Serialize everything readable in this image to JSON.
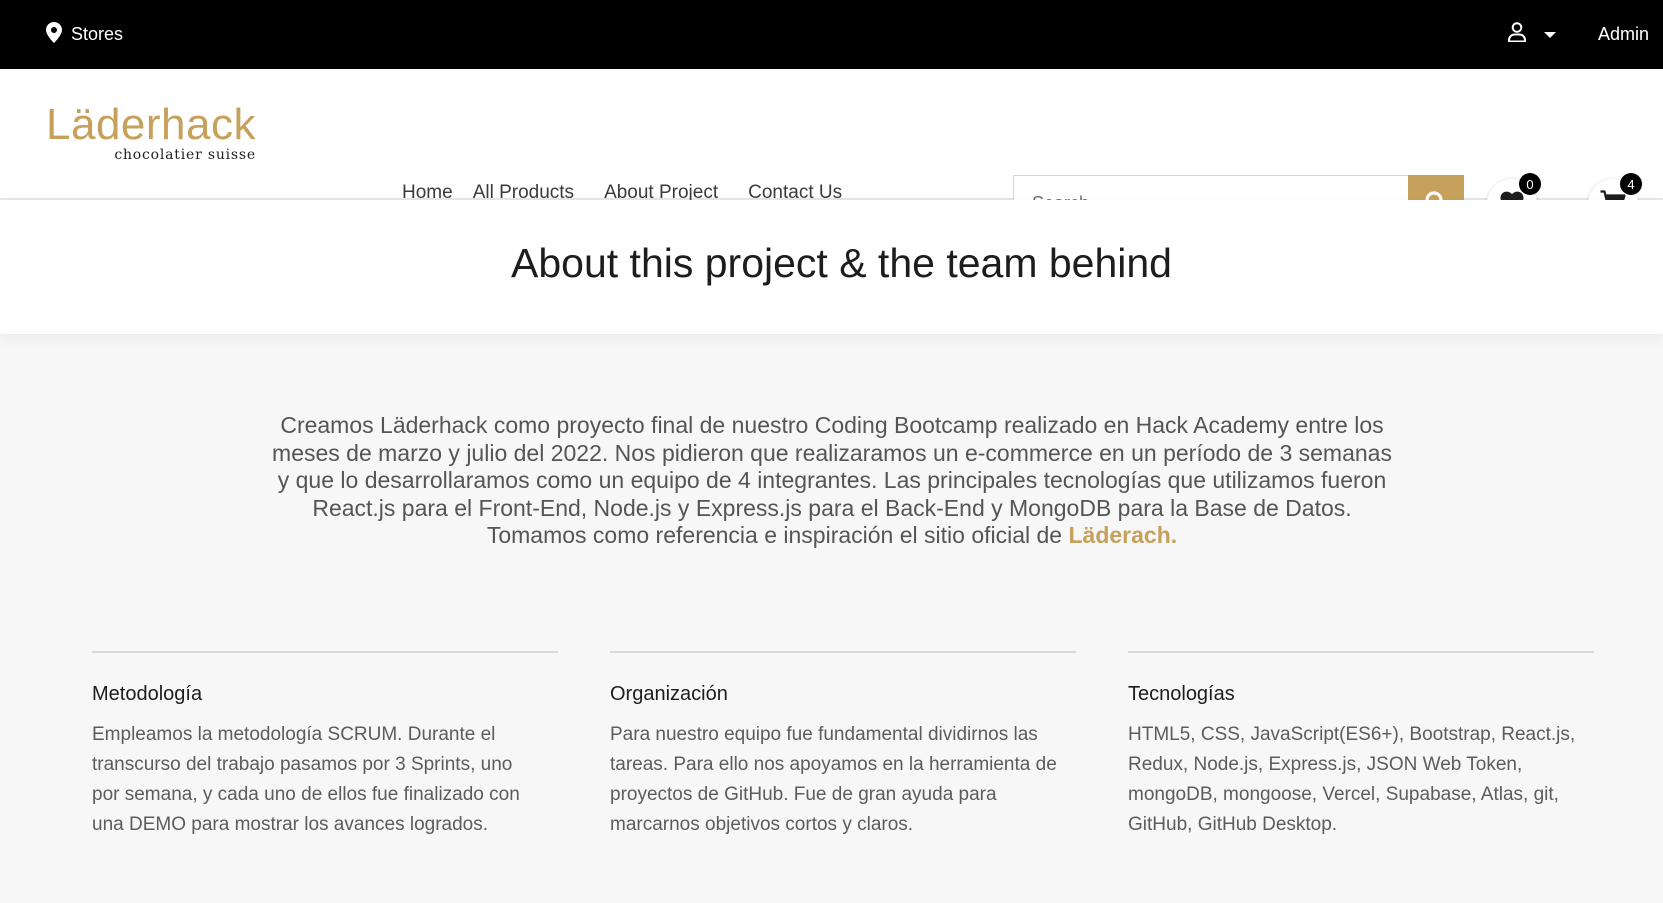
{
  "topbar": {
    "stores_label": "Stores",
    "user_label": "Admin"
  },
  "header": {
    "logo_main": "Läderhack",
    "logo_sub": "chocolatier suisse",
    "nav": [
      "Home",
      "All Products",
      "About Project",
      "Contact Us"
    ],
    "search_placeholder": "Search",
    "wishlist_count": "0",
    "cart_count": "4"
  },
  "hero": {
    "title": "About this project & the team behind"
  },
  "intro": {
    "text": "Creamos Läderhack como proyecto final de nuestro Coding Bootcamp realizado en Hack Academy entre los meses de marzo y julio del 2022. Nos pidieron que realizaramos un e-commerce en un período de 3 semanas y que lo desarrollaramos como un equipo de 4 integrantes. Las principales tecnologías que utilizamos fueron React.js para el Front-End, Node.js y Express.js para el Back-End y MongoDB para la Base de Datos. Tomamos como referencia e inspiración el sitio oficial de ",
    "link": "Läderach."
  },
  "columns": [
    {
      "title": "Metodología",
      "text": "Empleamos la metodología SCRUM. Durante el transcurso del trabajo pasamos por 3 Sprints, uno por semana, y cada uno de ellos fue finalizado con una DEMO para mostrar los avances logrados."
    },
    {
      "title": "Organización",
      "text": "Para nuestro equipo fue fundamental dividirnos las tareas. Para ello nos apoyamos en la herramienta de proyectos de GitHub. Fue de gran ayuda para marcarnos objetivos cortos y claros."
    },
    {
      "title": "Tecnologías",
      "text": "HTML5, CSS, JavaScript(ES6+), Bootstrap, React.js, Redux, Node.js, Express.js, JSON Web Token, mongoDB, mongoose, Vercel, Supabase, Atlas, git, GitHub, GitHub Desktop."
    }
  ],
  "colors": {
    "accent": "#c6a15b",
    "topbar": "#000000"
  }
}
